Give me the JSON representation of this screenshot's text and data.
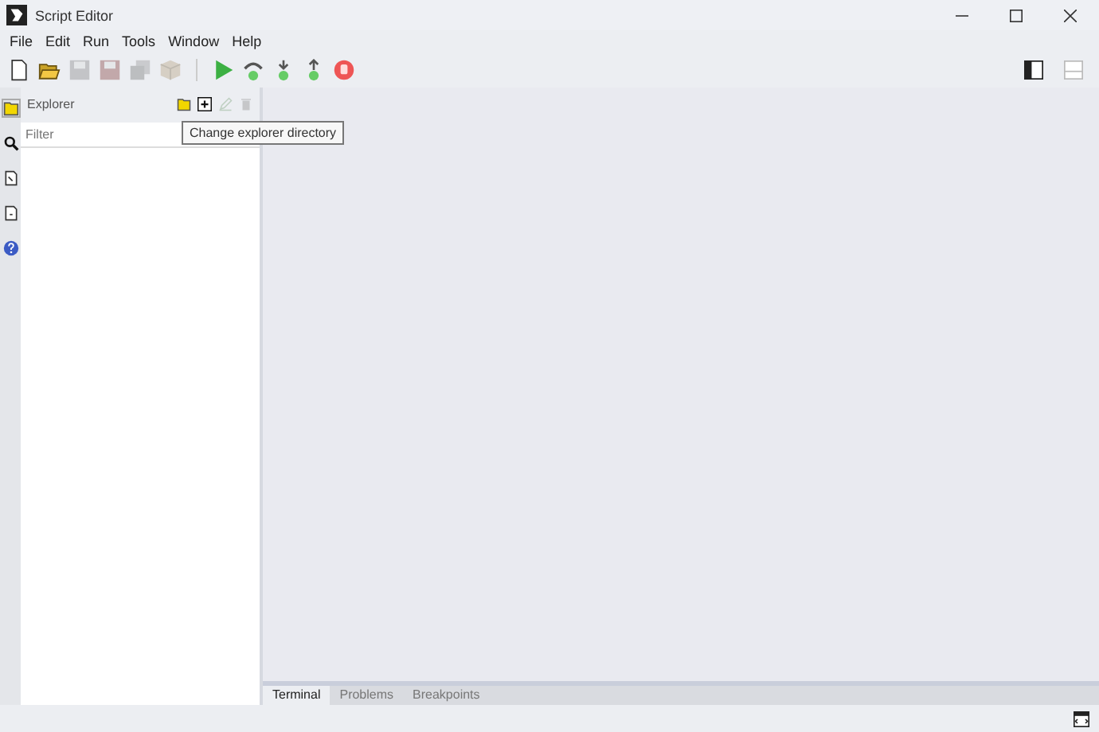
{
  "window": {
    "title": "Script Editor"
  },
  "menu": [
    "File",
    "Edit",
    "Run",
    "Tools",
    "Window",
    "Help"
  ],
  "toolbar": [
    {
      "kind": "new",
      "disabled": false
    },
    {
      "kind": "open",
      "disabled": false
    },
    {
      "kind": "save",
      "disabled": true
    },
    {
      "kind": "saveas",
      "disabled": true
    },
    {
      "kind": "saveall",
      "disabled": true
    },
    {
      "kind": "package",
      "disabled": true
    },
    {
      "kind": "sep"
    },
    {
      "kind": "run",
      "disabled": false
    },
    {
      "kind": "stepover",
      "disabled": false
    },
    {
      "kind": "stepinto",
      "disabled": false
    },
    {
      "kind": "stepout",
      "disabled": false
    },
    {
      "kind": "stop",
      "disabled": false
    }
  ],
  "layout_toggles": [
    {
      "kind": "side",
      "selected": true
    },
    {
      "kind": "bottom",
      "selected": false
    }
  ],
  "side_tabs": [
    {
      "kind": "folder",
      "selected": true
    },
    {
      "kind": "search",
      "selected": false
    },
    {
      "kind": "doc",
      "selected": false
    },
    {
      "kind": "doc2",
      "selected": false
    },
    {
      "kind": "help",
      "selected": false
    }
  ],
  "explorer": {
    "title": "Explorer",
    "actions": [
      {
        "kind": "folder",
        "disabled": false
      },
      {
        "kind": "add",
        "disabled": false
      },
      {
        "kind": "edit",
        "disabled": true
      },
      {
        "kind": "delete",
        "disabled": true
      }
    ],
    "filter": {
      "placeholder": "Filter"
    },
    "tooltip": "Change explorer directory"
  },
  "bottom_tabs": [
    {
      "label": "Terminal",
      "selected": true
    },
    {
      "label": "Problems",
      "selected": false
    },
    {
      "label": "Breakpoints",
      "selected": false
    }
  ]
}
